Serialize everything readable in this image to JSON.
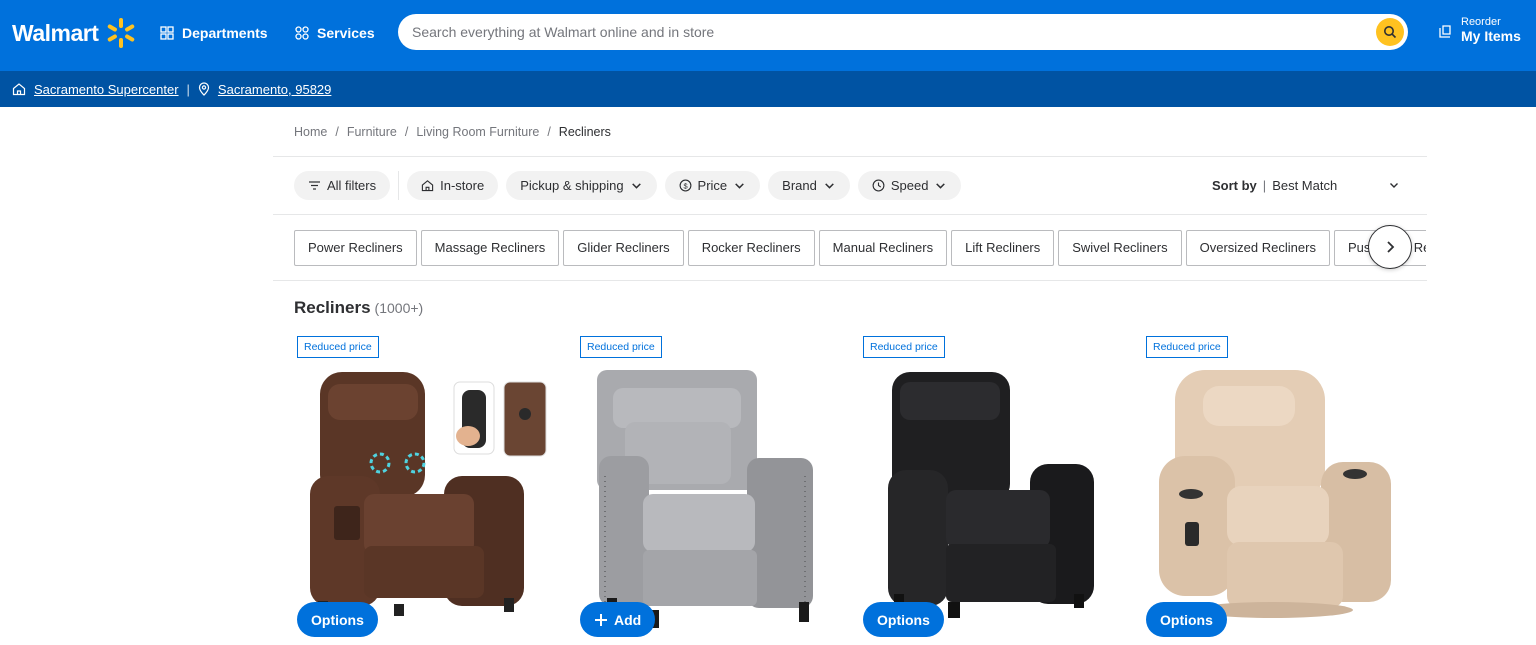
{
  "header": {
    "logo_text": "Walmart",
    "departments_label": "Departments",
    "services_label": "Services",
    "search_placeholder": "Search everything at Walmart online and in store",
    "reorder_small": "Reorder",
    "reorder_big": "My Items",
    "colors": {
      "primary": "#0071dc",
      "secondary_bar": "#0053a3",
      "spark": "#ffc220"
    }
  },
  "storebar": {
    "store": "Sacramento Supercenter",
    "location": "Sacramento, 95829"
  },
  "breadcrumb": [
    "Home",
    "Furniture",
    "Living Room Furniture",
    "Recliners"
  ],
  "filters": {
    "all_filters": "All filters",
    "in_store": "In-store",
    "pickup": "Pickup & shipping",
    "price": "Price",
    "brand": "Brand",
    "speed": "Speed"
  },
  "sort": {
    "label": "Sort by",
    "value": "Best Match"
  },
  "chips": [
    "Power Recliners",
    "Massage Recliners",
    "Glider Recliners",
    "Rocker Recliners",
    "Manual Recliners",
    "Lift Recliners",
    "Swivel Recliners",
    "Oversized Recliners",
    "Push Back Recliners"
  ],
  "results": {
    "title": "Recliners",
    "count": "(1000+)"
  },
  "products": [
    {
      "badge": "Reduced price",
      "cta": "Options",
      "color": "brown"
    },
    {
      "badge": "Reduced price",
      "cta": "Add",
      "color": "gray"
    },
    {
      "badge": "Reduced price",
      "cta": "Options",
      "color": "black"
    },
    {
      "badge": "Reduced price",
      "cta": "Options",
      "color": "beige"
    }
  ]
}
